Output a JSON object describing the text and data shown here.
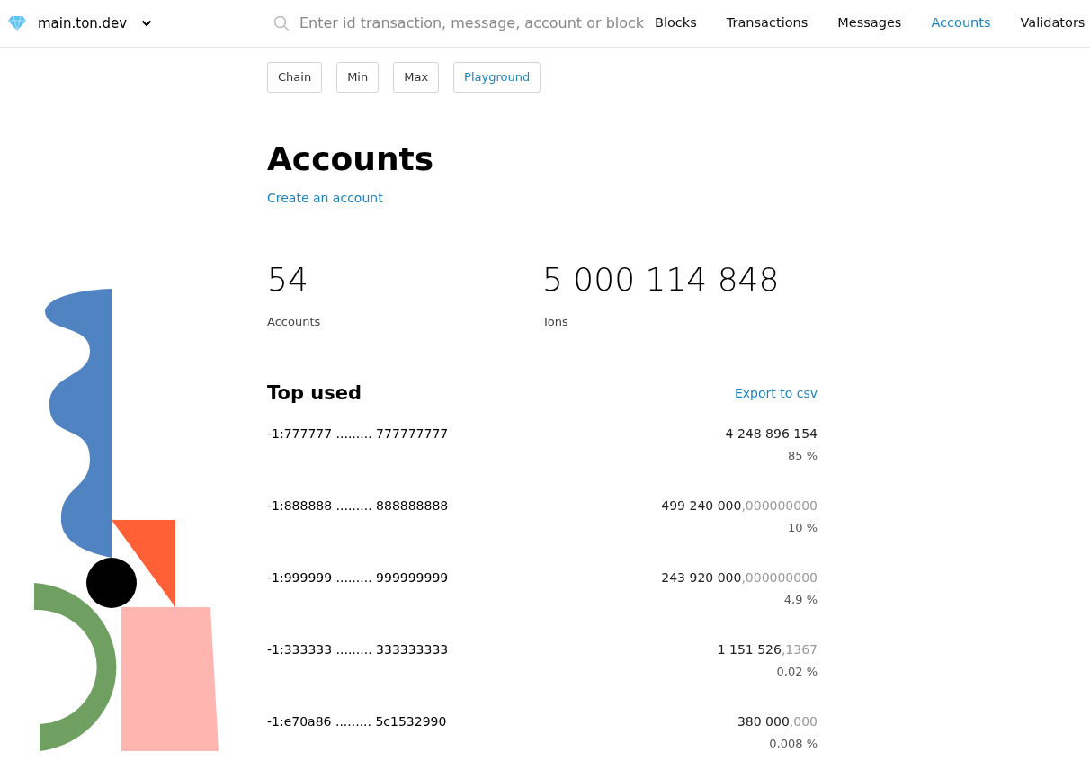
{
  "header": {
    "network": "main.ton.dev",
    "search": {
      "placeholder": "Enter id transaction, message, account or block"
    },
    "nav": [
      {
        "label": "Blocks",
        "selected": false
      },
      {
        "label": "Transactions",
        "selected": false
      },
      {
        "label": "Messages",
        "selected": false
      },
      {
        "label": "Accounts",
        "selected": true
      },
      {
        "label": "Validators",
        "selected": false
      }
    ]
  },
  "filters": [
    {
      "label": "Chain",
      "selected": false
    },
    {
      "label": "Min",
      "selected": false
    },
    {
      "label": "Max",
      "selected": false
    },
    {
      "label": "Playground",
      "selected": true
    }
  ],
  "page_title": "Accounts",
  "create_link": "Create an account",
  "stats": [
    {
      "value": "54",
      "label": "Accounts"
    },
    {
      "value": "5 000 114 848",
      "label": "Tons"
    }
  ],
  "top_used": {
    "title": "Top used",
    "export_link": "Export to csv",
    "rows": [
      {
        "address": "-1:777777 ......... 777777777",
        "amount": "4 248 896 154",
        "fraction": "",
        "percent": "85 %"
      },
      {
        "address": "-1:888888 ......... 888888888",
        "amount": "499 240 000",
        "fraction": ",000000000",
        "percent": "10 %"
      },
      {
        "address": "-1:999999 ......... 999999999",
        "amount": "243 920 000",
        "fraction": ",000000000",
        "percent": "4,9 %"
      },
      {
        "address": "-1:333333 ......... 333333333",
        "amount": "1 151 526",
        "fraction": ",1367",
        "percent": "0,02 %"
      },
      {
        "address": "-1:e70a86 ......... 5c1532990",
        "amount": "380 000",
        "fraction": ",000",
        "percent": "0,008 %"
      }
    ]
  }
}
